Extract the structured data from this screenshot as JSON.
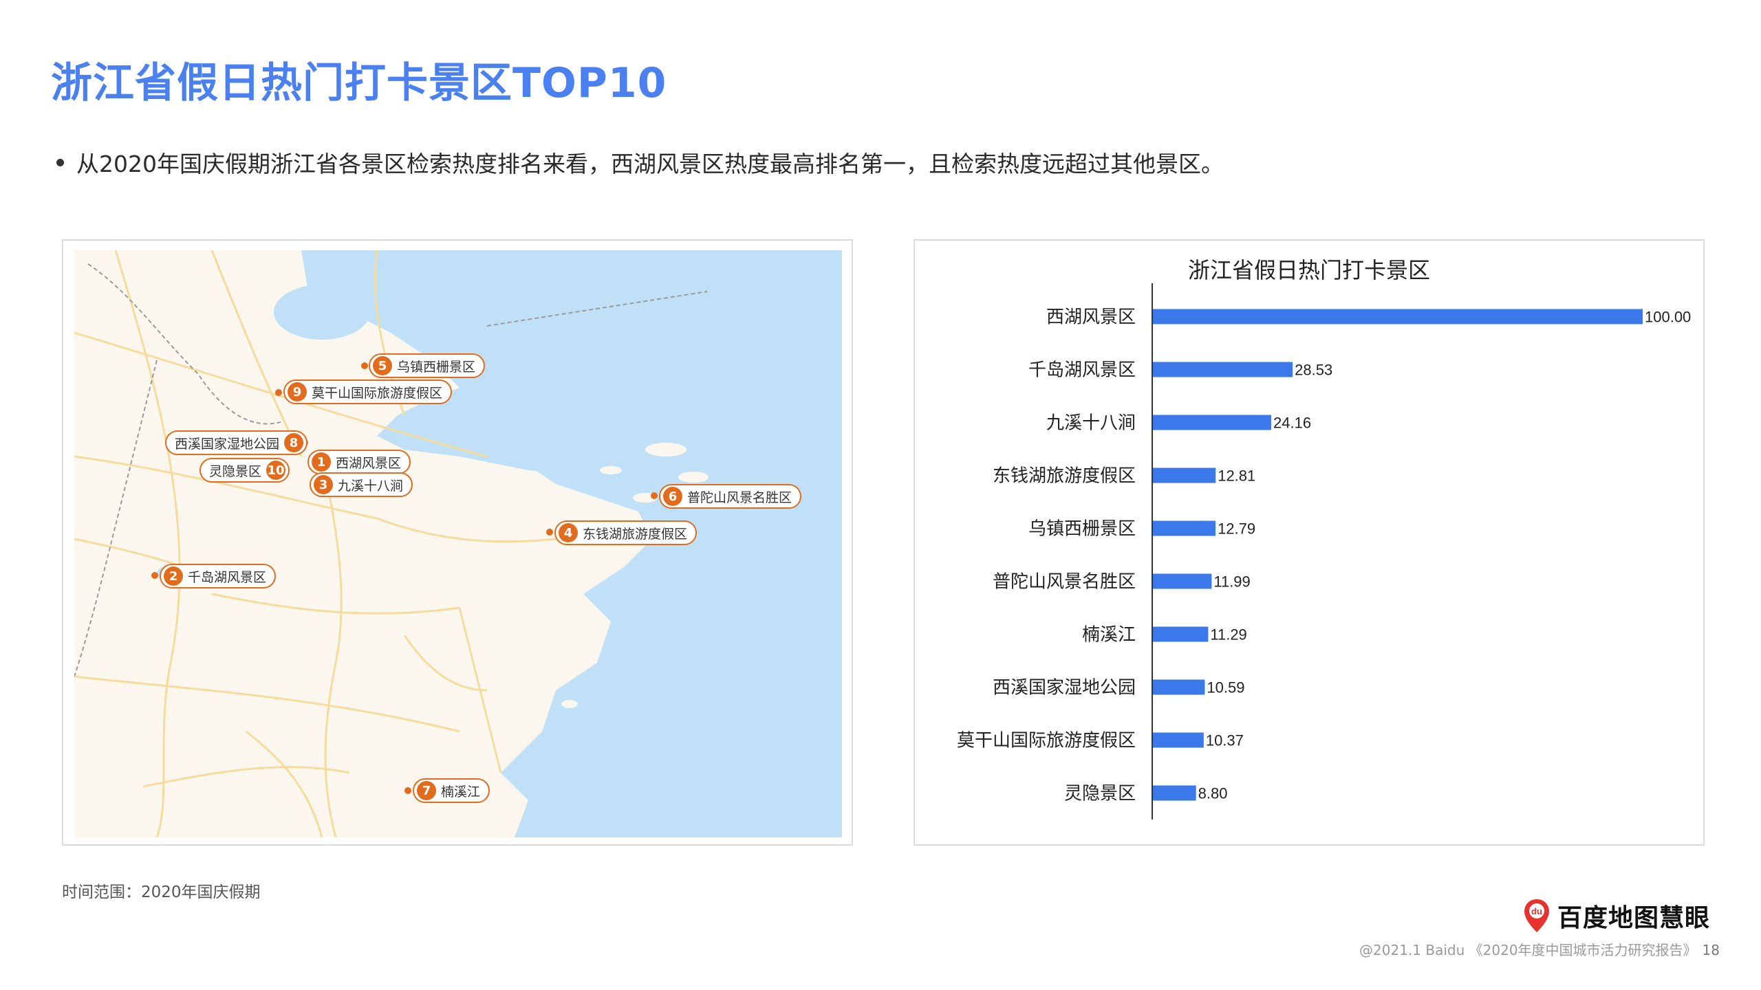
{
  "page": {
    "title": "浙江省假日热门打卡景区TOP10",
    "bullet": "从2020年国庆假期浙江省各景区检索热度排名来看，西湖风景区热度最高排名第一，且检索热度远超过其他景区。",
    "footnote": "时间范围：2020年国庆假期",
    "brand": "百度地图慧眼",
    "brand_badge": "du",
    "footer_note": "@2021.1 Baidu 《2020年度中国城市活力研究报告》",
    "page_number": "18"
  },
  "map": {
    "icon": "map-of-zhejiang",
    "colors": {
      "sea": "#bfe0f7",
      "land": "#fbf7ee",
      "road": "#f6dc9c",
      "border": "#9a9a9a",
      "marker": "#e26b1d"
    },
    "markers": [
      {
        "rank": "1",
        "name": "西湖风景区"
      },
      {
        "rank": "2",
        "name": "千岛湖风景区"
      },
      {
        "rank": "3",
        "name": "九溪十八涧"
      },
      {
        "rank": "4",
        "name": "东钱湖旅游度假区"
      },
      {
        "rank": "5",
        "name": "乌镇西栅景区"
      },
      {
        "rank": "6",
        "name": "普陀山风景名胜区"
      },
      {
        "rank": "7",
        "name": "楠溪江"
      },
      {
        "rank": "8",
        "name": "西溪国家湿地公园"
      },
      {
        "rank": "9",
        "name": "莫干山国际旅游度假区"
      },
      {
        "rank": "10",
        "name": "灵隐景区"
      }
    ]
  },
  "chart_data": {
    "type": "bar",
    "orientation": "horizontal",
    "title": "浙江省假日热门打卡景区",
    "categories": [
      "西湖风景区",
      "千岛湖风景区",
      "九溪十八涧",
      "东钱湖旅游度假区",
      "乌镇西栅景区",
      "普陀山风景名胜区",
      "楠溪江",
      "西溪国家湿地公园",
      "莫干山国际旅游度假区",
      "灵隐景区"
    ],
    "values": [
      100.0,
      28.53,
      24.16,
      12.81,
      12.79,
      11.99,
      11.29,
      10.59,
      10.37,
      8.8
    ],
    "value_labels": [
      "100.00",
      "28.53",
      "24.16",
      "12.81",
      "12.79",
      "11.99",
      "11.29",
      "10.59",
      "10.37",
      "8.80"
    ],
    "xlim": [
      0,
      100
    ],
    "bar_color": "#3b79ea",
    "grid": false,
    "legend": "none"
  }
}
